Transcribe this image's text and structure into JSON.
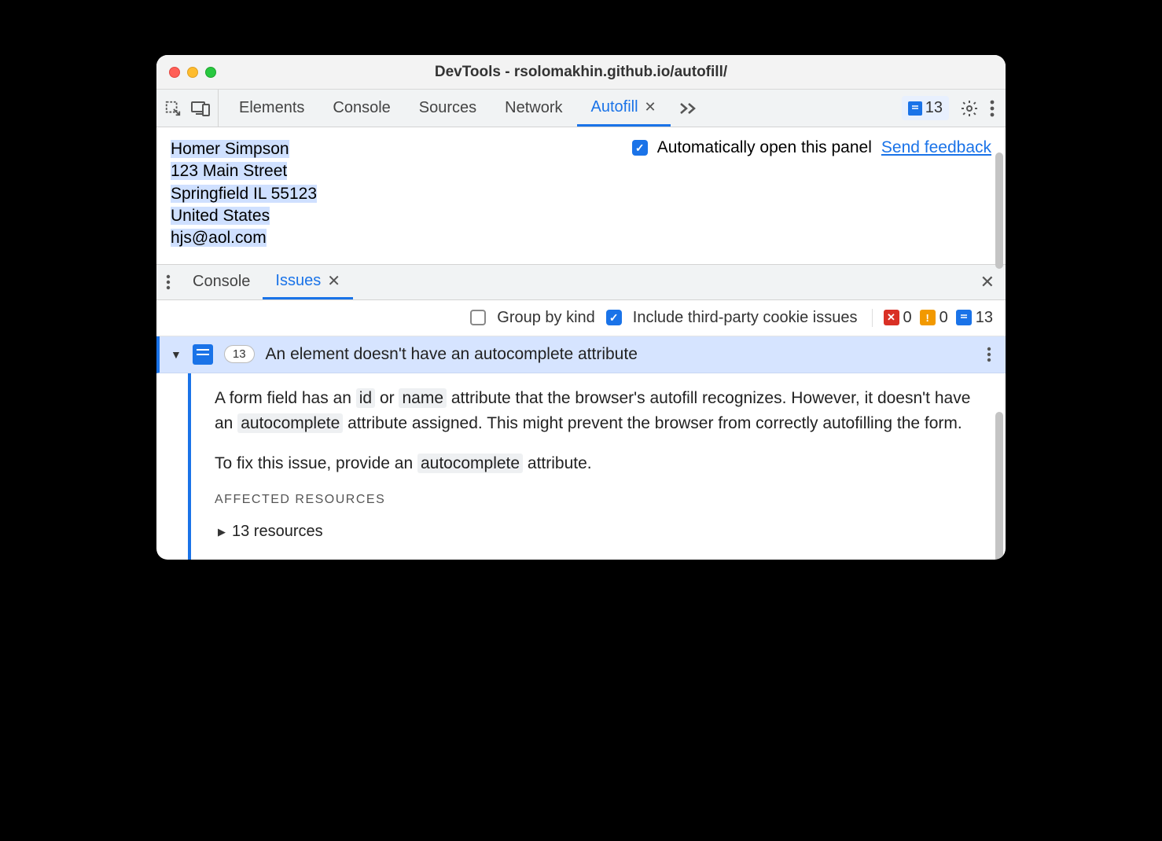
{
  "title": "DevTools - rsolomakhin.github.io/autofill/",
  "tabs": {
    "elements": "Elements",
    "console": "Console",
    "sources": "Sources",
    "network": "Network",
    "autofill": "Autofill"
  },
  "toolbar": {
    "issues_count": "13"
  },
  "autofill_panel": {
    "address_lines": [
      "Homer Simpson",
      "123 Main Street",
      "Springfield IL 55123",
      "United States",
      "hjs@aol.com"
    ],
    "auto_open_label": "Automatically open this panel",
    "feedback_link": "Send feedback"
  },
  "drawer": {
    "console_tab": "Console",
    "issues_tab": "Issues"
  },
  "filters": {
    "group_by_kind": "Group by kind",
    "include_third_party": "Include third-party cookie issues",
    "error_count": "0",
    "warning_count": "0",
    "info_count": "13"
  },
  "issue": {
    "count_pill": "13",
    "title": "An element doesn't have an autocomplete attribute",
    "p1_a": "A form field has an ",
    "kw_id": "id",
    "p1_b": " or ",
    "kw_name": "name",
    "p1_c": " attribute that the browser's autofill recognizes. However, it doesn't have an ",
    "kw_auto": "autocomplete",
    "p1_d": " attribute assigned. This might prevent the browser from correctly autofilling the form.",
    "p2_a": "To fix this issue, provide an ",
    "kw_auto2": "autocomplete",
    "p2_b": " attribute.",
    "affected_heading": "AFFECTED RESOURCES",
    "resources_line": "13 resources"
  }
}
